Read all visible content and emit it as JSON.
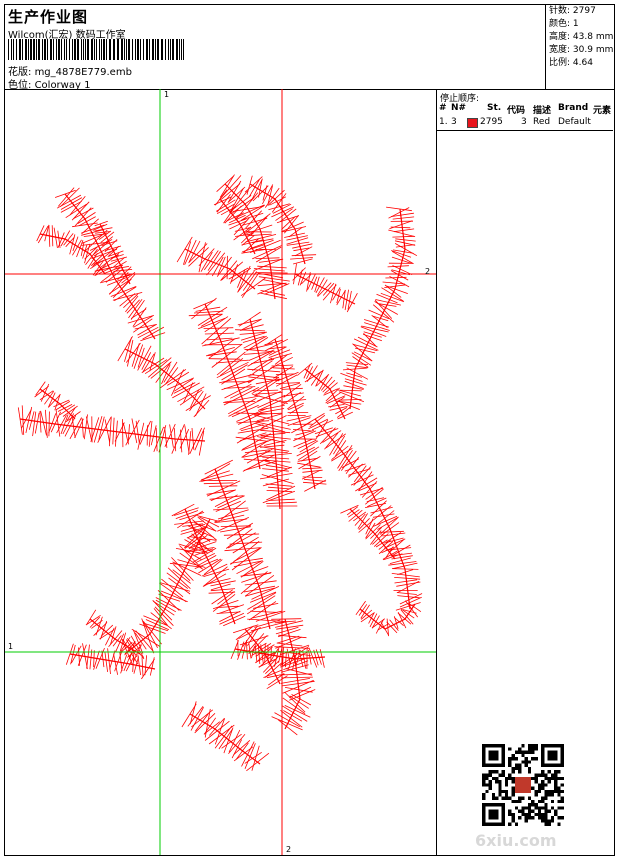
{
  "header": {
    "title": "生产作业图",
    "company": "Wilcom(汇宏) 数码工作室",
    "design_label": "花版:",
    "design_file": "mg_4878E779.emb",
    "colorway_label": "色位:",
    "colorway": "Colorway 1"
  },
  "stats": [
    {
      "label": "针数:",
      "value": "2797"
    },
    {
      "label": "颜色:",
      "value": "1"
    },
    {
      "label": "高度:",
      "value": "43.8 mm"
    },
    {
      "label": "宽度:",
      "value": "30.9 mm"
    },
    {
      "label": "比例:",
      "value": "4.64"
    }
  ],
  "stop_sequence": {
    "title": "停止顺序:",
    "columns": [
      "#",
      "N#",
      "St.",
      "代码",
      "描述",
      "Brand",
      "元素"
    ],
    "rows": [
      {
        "index": "1.",
        "needle": "3",
        "stitches": "2795",
        "code": "3",
        "description": "Red",
        "brand": "Default",
        "element": "",
        "color": "#e8141c"
      }
    ]
  },
  "axis_markers": {
    "top": "1",
    "right": "2",
    "left": "1",
    "bottom": "2"
  },
  "watermark": "6xiu.com",
  "colors": {
    "thread": "#ff0000",
    "guide_green": "#00cc00",
    "guide_red": "#ff0000"
  }
}
